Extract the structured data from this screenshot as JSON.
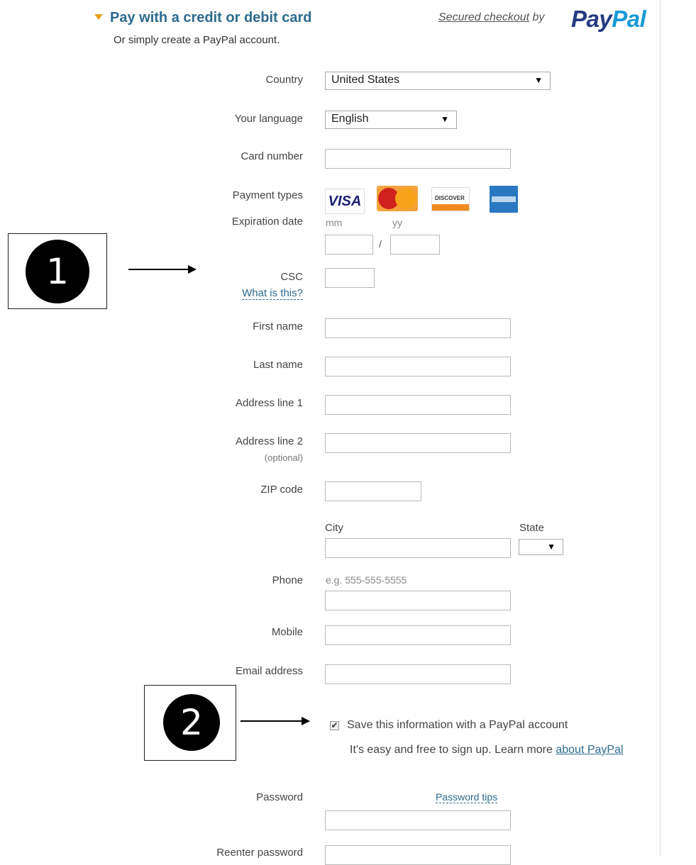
{
  "header": {
    "title": "Pay with a credit or debit card",
    "subtitle": "Or simply create a PayPal account.",
    "secured_link": "Secured checkout",
    "secured_by": "by",
    "logo_pay": "Pay",
    "logo_pal": "Pal"
  },
  "form": {
    "country_label": "Country",
    "country_value": "United States",
    "language_label": "Your language",
    "language_value": "English",
    "card_number_label": "Card number",
    "payment_types_label": "Payment types",
    "payment_types": [
      {
        "name": "VISA",
        "icon": "visa-logo"
      },
      {
        "name": "MasterCard",
        "icon": "mastercard-logo"
      },
      {
        "name": "DISCOVER",
        "icon": "discover-logo"
      },
      {
        "name": "American Express",
        "icon": "amex-logo"
      }
    ],
    "expiration_label": "Expiration date",
    "exp_mm": "mm",
    "exp_yy": "yy",
    "exp_sep": "/",
    "csc_label": "CSC",
    "csc_help": "What is this?",
    "first_name_label": "First name",
    "last_name_label": "Last name",
    "address1_label": "Address line 1",
    "address2_label": "Address line 2",
    "address2_note": "(optional)",
    "zip_label": "ZIP code",
    "city_label": "City",
    "state_label": "State",
    "phone_label": "Phone",
    "phone_hint": "e.g. 555-555-5555",
    "mobile_label": "Mobile",
    "email_label": "Email address",
    "save_label": "Save this information with a PayPal account",
    "signup_text": "It's easy and free to sign up. Learn more",
    "signup_link": "about PayPal",
    "password_label": "Password",
    "password_tips": "Password tips",
    "reenter_password_label": "Reenter password"
  },
  "callouts": [
    {
      "number": "1"
    },
    {
      "number": "2"
    }
  ],
  "colors": {
    "accent": "#2d6a8e",
    "paypal_dark": "#253b80",
    "paypal_light": "#179bd7"
  }
}
